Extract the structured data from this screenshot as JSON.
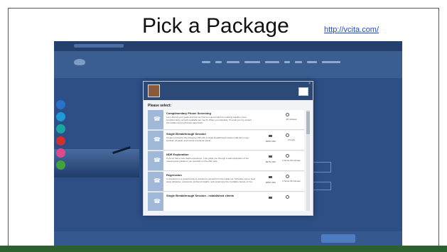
{
  "slide": {
    "title": "Pick a Package",
    "link": "http://vcita.com/"
  },
  "colors": {
    "bottom_bar": "#2e5f2e",
    "site_background": "#3c6aa8",
    "modal_header": "#2c4a78",
    "service_icon": "#9fb8d8",
    "side_buttons": [
      "#2a72c9",
      "#1e9bd6",
      "#1aa6a0",
      "#d0312d",
      "#e04a8a",
      "#3fa43a"
    ]
  },
  "icons": {
    "service": "phone-icon",
    "price": "credit-card-icon",
    "duration": "clock-icon"
  },
  "modal": {
    "prompt": "Please select:",
    "services": [
      {
        "title": "Complimentary Phone Screening",
        "description": "Let's discuss your goals and find out if we're a good match for working together. Free complimentary consults available per month. When you schedule, I'll email you my contact information and preliminary paperwork.",
        "price": "",
        "duration": "30 minutes"
      },
      {
        "title": "Single Breakthrough Session",
        "description": "Create a powerful, life-changing shift with a single breakthrough session tailored to your spiritual, physical, and mental emotional needs.",
        "price": "$250 USD",
        "duration": "2 hours"
      },
      {
        "title": "NDE Exploration",
        "description": "If you've had a near death experience, I can guide you through a safe exploration of the meaning and guidance you received on the other side.",
        "price": "$375 USD",
        "duration": "2 hours 30 minutes"
      },
      {
        "title": "Regression",
        "description": "A regression is a powerful way to transform yourself from the inside out. Schedule now to clear away obstacles, experience profound insights, and experience the crystalline beauty of You.",
        "price": "$250 USD",
        "duration": "2 hours 30 minutes"
      },
      {
        "title": "Single Breakthrough Session - established clients",
        "description": "",
        "price": "",
        "duration": ""
      }
    ]
  }
}
